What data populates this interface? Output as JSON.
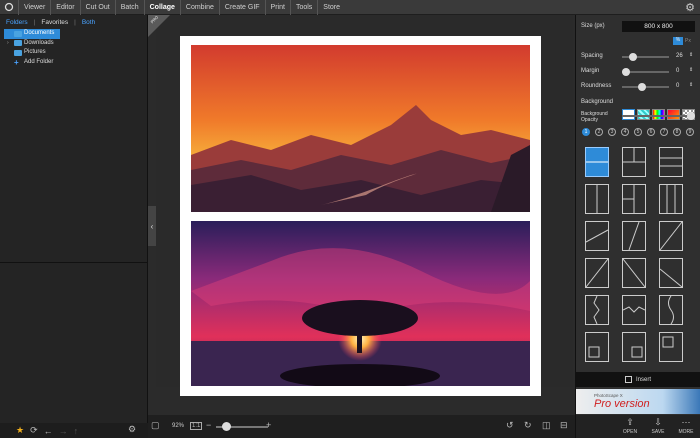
{
  "menubar": {
    "items": [
      "Viewer",
      "Editor",
      "Cut Out",
      "Batch",
      "Collage",
      "Combine",
      "Create GIF",
      "Print",
      "Tools",
      "Store"
    ],
    "active": "Collage"
  },
  "browser": {
    "tabs": [
      "Folders",
      "Favorites",
      "Both"
    ],
    "tree": [
      {
        "label": "Documents",
        "selected": true
      },
      {
        "label": "Downloads",
        "selected": false
      },
      {
        "label": "Pictures",
        "selected": false
      }
    ],
    "add_folder": "Add Folder"
  },
  "badge": "PRO",
  "zoom": {
    "label": "92%",
    "fit_label": "1:1",
    "level": 0.2
  },
  "properties": {
    "size_label": "Size (px)",
    "size_value": "800 x 800",
    "unit_percent": "%",
    "unit_px": "Px",
    "spacing_label": "Spacing",
    "spacing_value": "26",
    "margin_label": "Margin",
    "margin_value": "0",
    "roundness_label": "Roundness",
    "roundness_value": "0",
    "background_label": "Background",
    "opacity_label": "Background\nOpacity",
    "presets": [
      "1",
      "2",
      "3",
      "4",
      "5",
      "6",
      "7",
      "8",
      "9"
    ],
    "selected_preset": "1",
    "insert_label": "Insert"
  },
  "promo": {
    "line1": "PhotoScape X",
    "line2": "Pro version"
  },
  "actions": {
    "open": "OPEN",
    "save": "SAVE",
    "more": "MORE"
  }
}
